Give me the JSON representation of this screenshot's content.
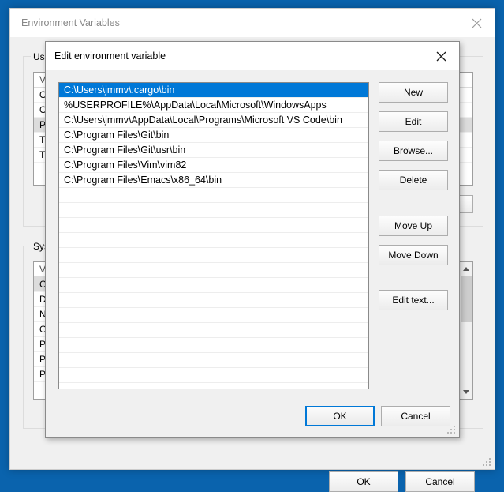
{
  "desktop": {
    "background_color": "#0a63ad"
  },
  "outer_window": {
    "title": "Environment Variables",
    "close_icon": "close-icon",
    "user_section": {
      "label": "User variables for jmmv",
      "column_header": "Variable",
      "rows": [
        {
          "text": "OneDrive",
          "selected": false
        },
        {
          "text": "OneDriveConsumer",
          "selected": false
        },
        {
          "text": "Path",
          "selected": true
        },
        {
          "text": "TEMP",
          "selected": false
        },
        {
          "text": "TMP",
          "selected": false
        }
      ]
    },
    "system_section": {
      "label": "System variables",
      "column_header": "Variable",
      "rows": [
        {
          "text": "ComSpec",
          "selected": true
        },
        {
          "text": "DriverData",
          "selected": false
        },
        {
          "text": "NUMBER_OF_PROCESSORS",
          "selected": false
        },
        {
          "text": "OS",
          "selected": false
        },
        {
          "text": "Path",
          "selected": false
        },
        {
          "text": "PATHEXT",
          "selected": false
        },
        {
          "text": "PROCESSOR_ARCHITECTURE",
          "selected": false
        }
      ]
    },
    "ok_label": "OK",
    "cancel_label": "Cancel",
    "resize_grip": "resize-grip-icon"
  },
  "edit_dialog": {
    "title": "Edit environment variable",
    "close_icon": "close-icon",
    "selection_color": "#0078d7",
    "paths": [
      "C:\\Users\\jmmv\\.cargo\\bin",
      "%USERPROFILE%\\AppData\\Local\\Microsoft\\WindowsApps",
      "C:\\Users\\jmmv\\AppData\\Local\\Programs\\Microsoft VS Code\\bin",
      "C:\\Program Files\\Git\\bin",
      "C:\\Program Files\\Git\\usr\\bin",
      "C:\\Program Files\\Vim\\vim82",
      "C:\\Program Files\\Emacs\\x86_64\\bin"
    ],
    "selected_index": 0,
    "empty_row_count": 13,
    "buttons": {
      "new": "New",
      "edit": "Edit",
      "browse": "Browse...",
      "delete": "Delete",
      "move_up": "Move Up",
      "move_down": "Move Down",
      "edit_text": "Edit text..."
    },
    "ok_label": "OK",
    "cancel_label": "Cancel",
    "resize_grip": "resize-grip-icon"
  }
}
